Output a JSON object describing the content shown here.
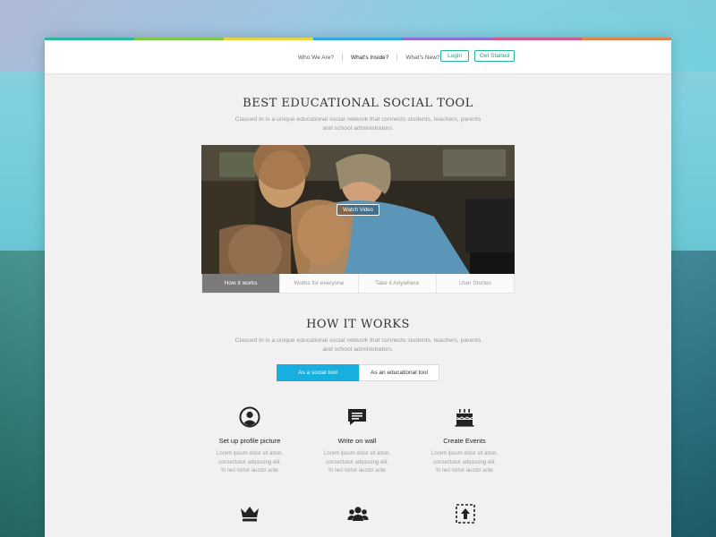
{
  "accent_colors": [
    "#2bb8a0",
    "#7fc84a",
    "#e7d44a",
    "#2fa7e0",
    "#8e6fd0",
    "#d45a8e",
    "#e0844a"
  ],
  "nav": {
    "links": [
      {
        "label": "Who We Are?",
        "active": false
      },
      {
        "label": "What's Inside?",
        "active": true
      },
      {
        "label": "What's New?",
        "active": false
      }
    ],
    "login_label": "Login",
    "get_started_label": "Get Started"
  },
  "hero": {
    "title": "BEST EDUCATIONAL SOCIAL TOOL",
    "subtitle_line1": "Classed In is a unique educational social network that connects students, teachers, parents",
    "subtitle_line2": "and school administrators.",
    "watch_video_label": "Watch Video",
    "tabs": [
      "How it works",
      "Works for everyone",
      "Take it Anywhere",
      "User Stories"
    ],
    "active_tab_index": 0
  },
  "how_it_works": {
    "title": "HOW IT WORKS",
    "subtitle_line1": "Classed In is a unique educational social network that connects students, teachers, parents",
    "subtitle_line2": "and school administrators.",
    "toggle": [
      "As a social tool",
      "As an educational tool"
    ],
    "active_toggle_index": 0,
    "features": [
      {
        "icon": "profile-icon",
        "title": "Set up profile picture",
        "text_line1": "Lorem ipsum dolor sit amet,",
        "text_line2": "consectetur adipiscing elit.",
        "text_line3": "In nec tortor auctor ante"
      },
      {
        "icon": "chat-icon",
        "title": "Write on wall",
        "text_line1": "Lorem ipsum dolor sit amet,",
        "text_line2": "consectetur adipiscing elit.",
        "text_line3": "In nec tortor auctor ante"
      },
      {
        "icon": "cake-icon",
        "title": "Create Events",
        "text_line1": "Lorem ipsum dolor sit amet,",
        "text_line2": "consectetur adipiscing elit.",
        "text_line3": "In nec tortor auctor ante"
      }
    ],
    "more_icons": [
      "crown-icon",
      "group-icon",
      "upload-icon"
    ]
  }
}
